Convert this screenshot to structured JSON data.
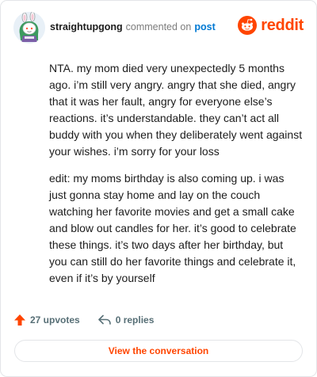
{
  "comment": {
    "author": "straightupgong",
    "action_text": "commented on",
    "post_link_label": "post",
    "brand": "reddit",
    "paragraphs": [
      "NTA. my mom died very unexpectedly 5 months ago. i’m still very angry. angry that she died, angry that it was her fault, angry for everyone else’s reactions. it’s understandable. they can’t act all buddy with you when they deliberately went against your wishes. i’m sorry for your loss",
      "edit: my moms birthday is also coming up. i was just gonna stay home and lay on the couch watching her favorite movies and get a small cake and blow out candles for her. it’s good to celebrate these things. it’s two days after her birthday, but you can still do her favorite things and celebrate it, even if it’s by yourself"
    ]
  },
  "footer": {
    "upvotes_label": "27 upvotes",
    "replies_label": "0 replies",
    "view_button_label": "View the conversation"
  },
  "colors": {
    "accent": "#ff4500",
    "link": "#0079d3",
    "muted": "#576f76"
  },
  "icons": {
    "avatar": "snoo-avatar",
    "logo": "reddit-snoo-icon",
    "upvote": "upvote-arrow-icon",
    "reply": "reply-arrow-icon"
  }
}
